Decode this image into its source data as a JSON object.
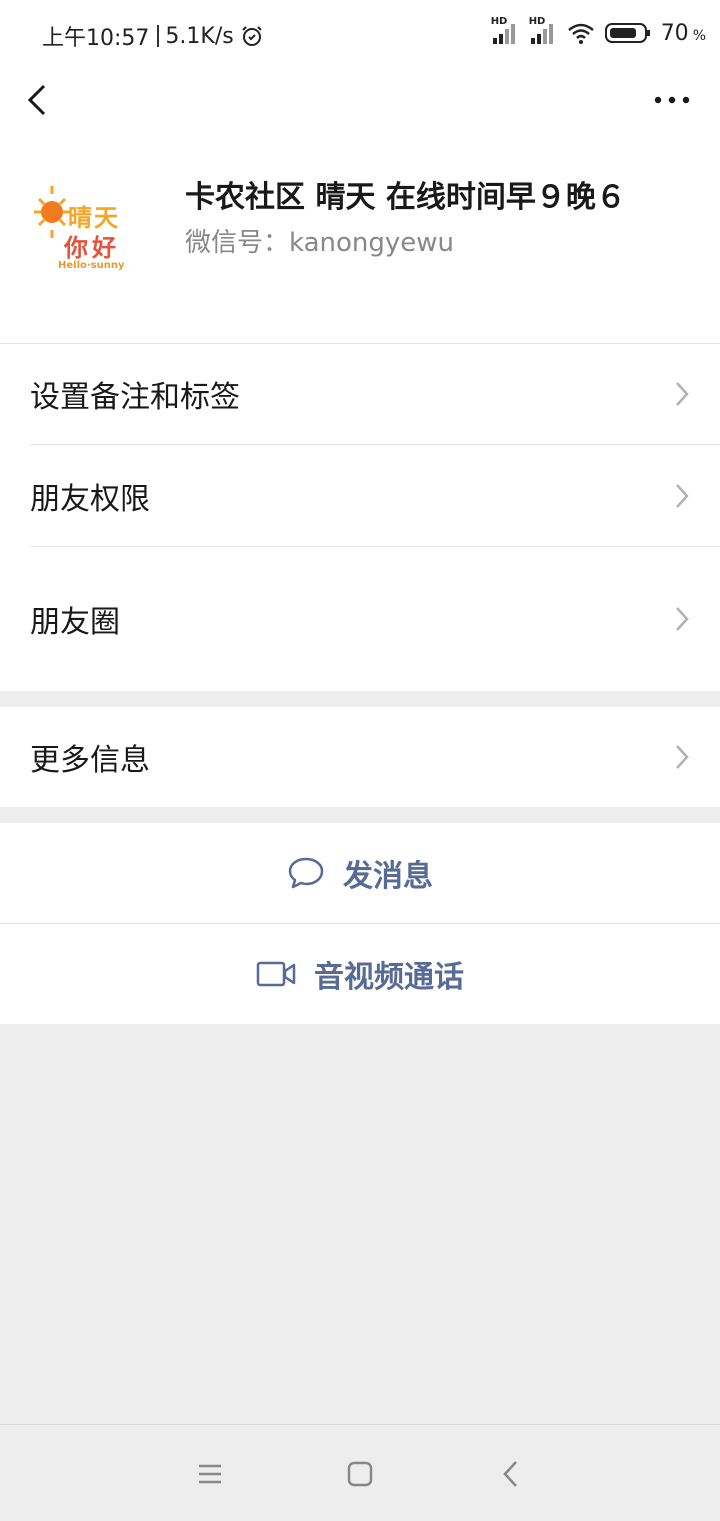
{
  "status_bar": {
    "time": "上午10:57",
    "net_speed": "5.1K/s",
    "battery": "70",
    "battery_unit": "%",
    "hd1": "HD",
    "hd2": "HD"
  },
  "nav": {
    "back_icon": "chevron-left-icon",
    "more_icon": "more-dots-icon"
  },
  "profile": {
    "name": "卡农社区 晴天 在线时间早９晚６",
    "wechat_id": "微信号：kanongyewu",
    "avatar_text_1": "晴天",
    "avatar_text_2": "你好",
    "avatar_text_3": "Hello·sunny"
  },
  "menu": {
    "remark_tags": "设置备注和标签",
    "friend_permissions": "朋友权限",
    "moments": "朋友圈",
    "more_info": "更多信息"
  },
  "actions": {
    "send_message": "发消息",
    "av_call": "音视频通话"
  },
  "colors": {
    "link": "#576b95",
    "background": "#ededed"
  }
}
